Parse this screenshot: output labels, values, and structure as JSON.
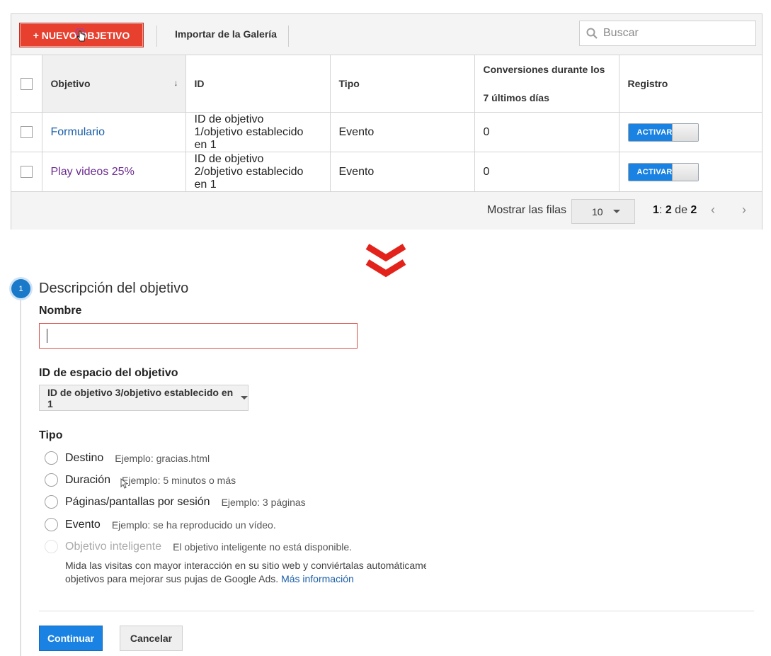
{
  "toolbar": {
    "new_goal_label": "+ NUEVO OBJETIVO",
    "import_label": "Importar de la Galería",
    "search_placeholder": "Buscar"
  },
  "table": {
    "headers": {
      "goal": "Objetivo",
      "id": "ID",
      "type": "Tipo",
      "conversions_line1": "Conversiones durante los",
      "conversions_line2": "7 últimos días",
      "recording": "Registro"
    },
    "rows": [
      {
        "goal": "Formulario",
        "id_line1": "ID de objetivo",
        "id_line2": "1/objetivo establecido",
        "id_line3": "en 1",
        "type": "Evento",
        "conversions": "0",
        "toggle": "ACTIVAR"
      },
      {
        "goal": "Play videos 25%",
        "id_line1": "ID de objetivo",
        "id_line2": "2/objetivo establecido",
        "id_line3": "en 1",
        "type": "Evento",
        "conversions": "0",
        "toggle": "ACTIVAR"
      }
    ],
    "footer": {
      "rows_label": "Mostrar las filas",
      "rows_value": "10",
      "page_start": "1",
      "page_sep": ":",
      "page_end": "2",
      "page_of": "de",
      "page_total": "2"
    }
  },
  "colors": {
    "new_goal_button": "#e8402f",
    "arrow_red": "#e3231b",
    "primary_blue": "#1a82e2",
    "link_blue": "#1a5fa8",
    "visited_purple": "#6b2c8f"
  },
  "form": {
    "step_number": "1",
    "section_title": "Descripción del objetivo",
    "name_label": "Nombre",
    "name_value": "",
    "slot_label": "ID de espacio del objetivo",
    "slot_value": "ID de objetivo 3/objetivo establecido en 1",
    "type_label": "Tipo",
    "types": [
      {
        "label": "Destino",
        "hint": "Ejemplo: gracias.html"
      },
      {
        "label": "Duración",
        "hint": "Ejemplo: 5 minutos o más"
      },
      {
        "label": "Páginas/pantallas por sesión",
        "hint": "Ejemplo: 3 páginas"
      },
      {
        "label": "Evento",
        "hint": "Ejemplo: se ha reproducido un vídeo."
      },
      {
        "label": "Objetivo inteligente",
        "hint": "El objetivo inteligente no está disponible."
      }
    ],
    "smart_desc_line1": "Mida las visitas con mayor interacción en su sitio web y conviértalas automáticame",
    "smart_desc_line2": "objetivos para mejorar sus pujas de Google Ads.",
    "more_info": "Más información",
    "continue_label": "Continuar",
    "cancel_label": "Cancelar"
  }
}
